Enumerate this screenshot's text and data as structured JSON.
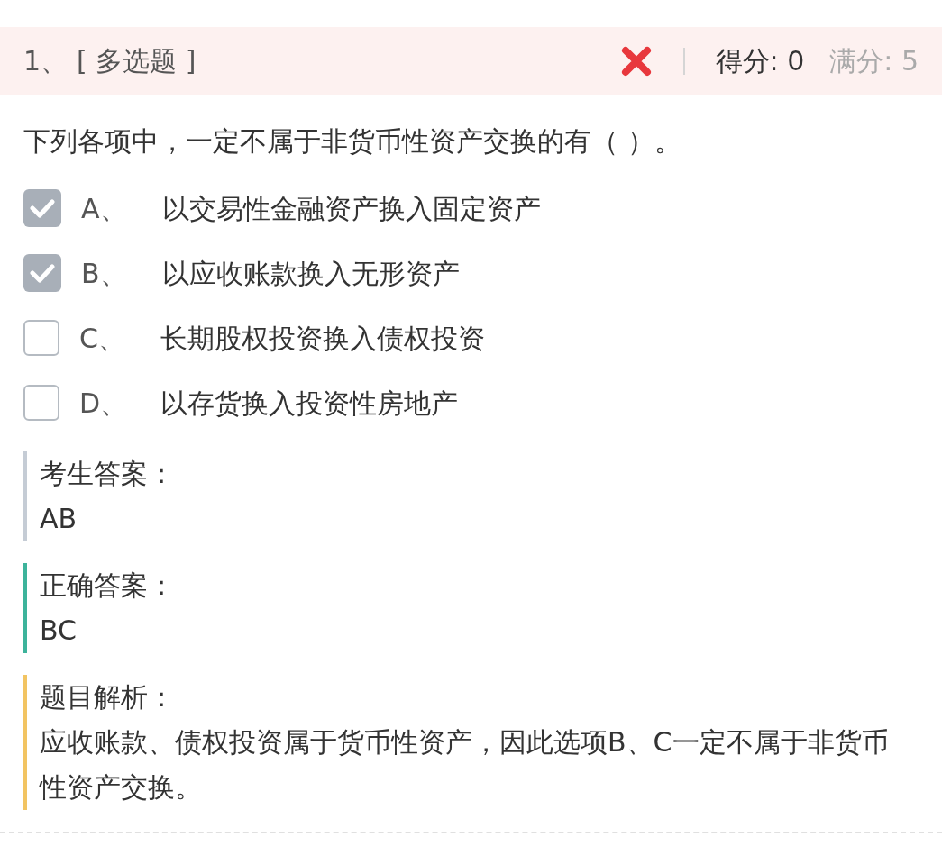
{
  "header": {
    "number": "1、",
    "type": "[ 多选题 ]",
    "correct": false,
    "score": "得分: 0",
    "full_score": "满分: 5"
  },
  "question": "下列各项中，一定不属于非货币性资产交换的有（ ）。",
  "options": [
    {
      "letter": "A、",
      "text": "以交易性金融资产换入固定资产",
      "checked": true
    },
    {
      "letter": "B、",
      "text": "以应收账款换入无形资产",
      "checked": true
    },
    {
      "letter": "C、",
      "text": "长期股权投资换入债权投资",
      "checked": false
    },
    {
      "letter": "D、",
      "text": "以存货换入投资性房地产",
      "checked": false
    }
  ],
  "sections": [
    {
      "title": "考生答案：",
      "body": "AB",
      "color": "#c5ccd5"
    },
    {
      "title": "正确答案：",
      "body": "BC",
      "color": "#3db39b"
    },
    {
      "title": "题目解析：",
      "body": "应收账款、债权投资属于货币性资产，因此选项B、C一定不属于非货币性资产交换。",
      "color": "#f2c462"
    }
  ]
}
